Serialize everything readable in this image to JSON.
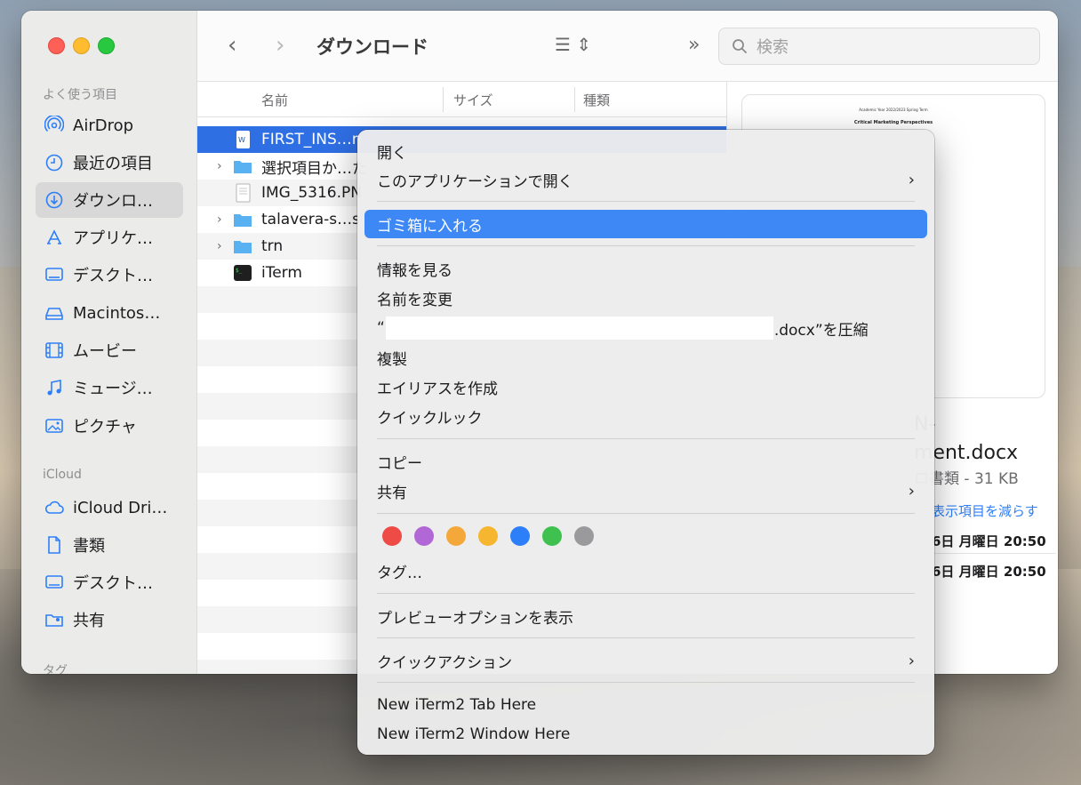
{
  "window": {
    "title": "ダウンロード",
    "search_placeholder": "検索",
    "back_icon": "chevron-left-icon",
    "forward_icon": "chevron-right-icon"
  },
  "sidebar": {
    "favorites_heading": "よく使う項目",
    "icloud_heading": "iCloud",
    "tags_heading": "タグ",
    "favorites": [
      {
        "label": "AirDrop",
        "icon": "airdrop-icon"
      },
      {
        "label": "最近の項目",
        "icon": "clock-icon"
      },
      {
        "label": "ダウンロ…",
        "icon": "download-icon"
      },
      {
        "label": "アプリケ…",
        "icon": "applications-icon"
      },
      {
        "label": "デスクト…",
        "icon": "desktop-icon"
      },
      {
        "label": "Macintos…",
        "icon": "disk-icon"
      },
      {
        "label": "ムービー",
        "icon": "film-icon"
      },
      {
        "label": "ミュージ…",
        "icon": "music-icon"
      },
      {
        "label": "ピクチャ",
        "icon": "photo-icon"
      }
    ],
    "icloud": [
      {
        "label": "iCloud Dri…",
        "icon": "cloud-icon"
      },
      {
        "label": "書類",
        "icon": "document-icon"
      },
      {
        "label": "デスクト…",
        "icon": "desktop-icon"
      },
      {
        "label": "共有",
        "icon": "shared-folder-icon"
      }
    ]
  },
  "list": {
    "columns": [
      "名前",
      "サイズ",
      "種類"
    ],
    "rows": [
      {
        "name": "FIRST_INS…n",
        "type": "docx",
        "selected": true
      },
      {
        "name": "選択項目か…た",
        "type": "folder"
      },
      {
        "name": "IMG_5316.PN",
        "type": "image"
      },
      {
        "name": "talavera-s…s",
        "type": "folder"
      },
      {
        "name": "trn",
        "type": "folder"
      },
      {
        "name": "iTerm",
        "type": "app"
      }
    ]
  },
  "preview": {
    "doc_line1": "Academic Year 2022/2023 Spring Term",
    "doc_line2": "Critical Marketing Perspectives",
    "name_line1": "N-",
    "name_line2": "ment.docx",
    "meta": "ロ書類 - 31 KB",
    "show_less": "表示項目を減らす",
    "date1": "6日 月曜日 20:50",
    "date2": "6日 月曜日 20:50"
  },
  "context_menu": {
    "open": "開く",
    "open_with": "このアプリケーションで開く",
    "move_to_trash": "ゴミ箱に入れる",
    "get_info": "情報を見る",
    "rename": "名前を変更",
    "compress_prefix": "“",
    "compress_suffix": ".docx”を圧縮",
    "duplicate": "複製",
    "make_alias": "エイリアスを作成",
    "quick_look": "クイックルック",
    "copy": "コピー",
    "share": "共有",
    "tags": "タグ…",
    "show_preview_options": "プレビューオプションを表示",
    "quick_actions": "クイックアクション",
    "new_iterm_tab": "New iTerm2 Tab Here",
    "new_iterm_window": "New iTerm2 Window Here",
    "tag_colors": [
      "#ee4b46",
      "#b168d6",
      "#f4a83a",
      "#f6b630",
      "#2d7ff9",
      "#3ec14f",
      "#9a9a9c"
    ]
  }
}
